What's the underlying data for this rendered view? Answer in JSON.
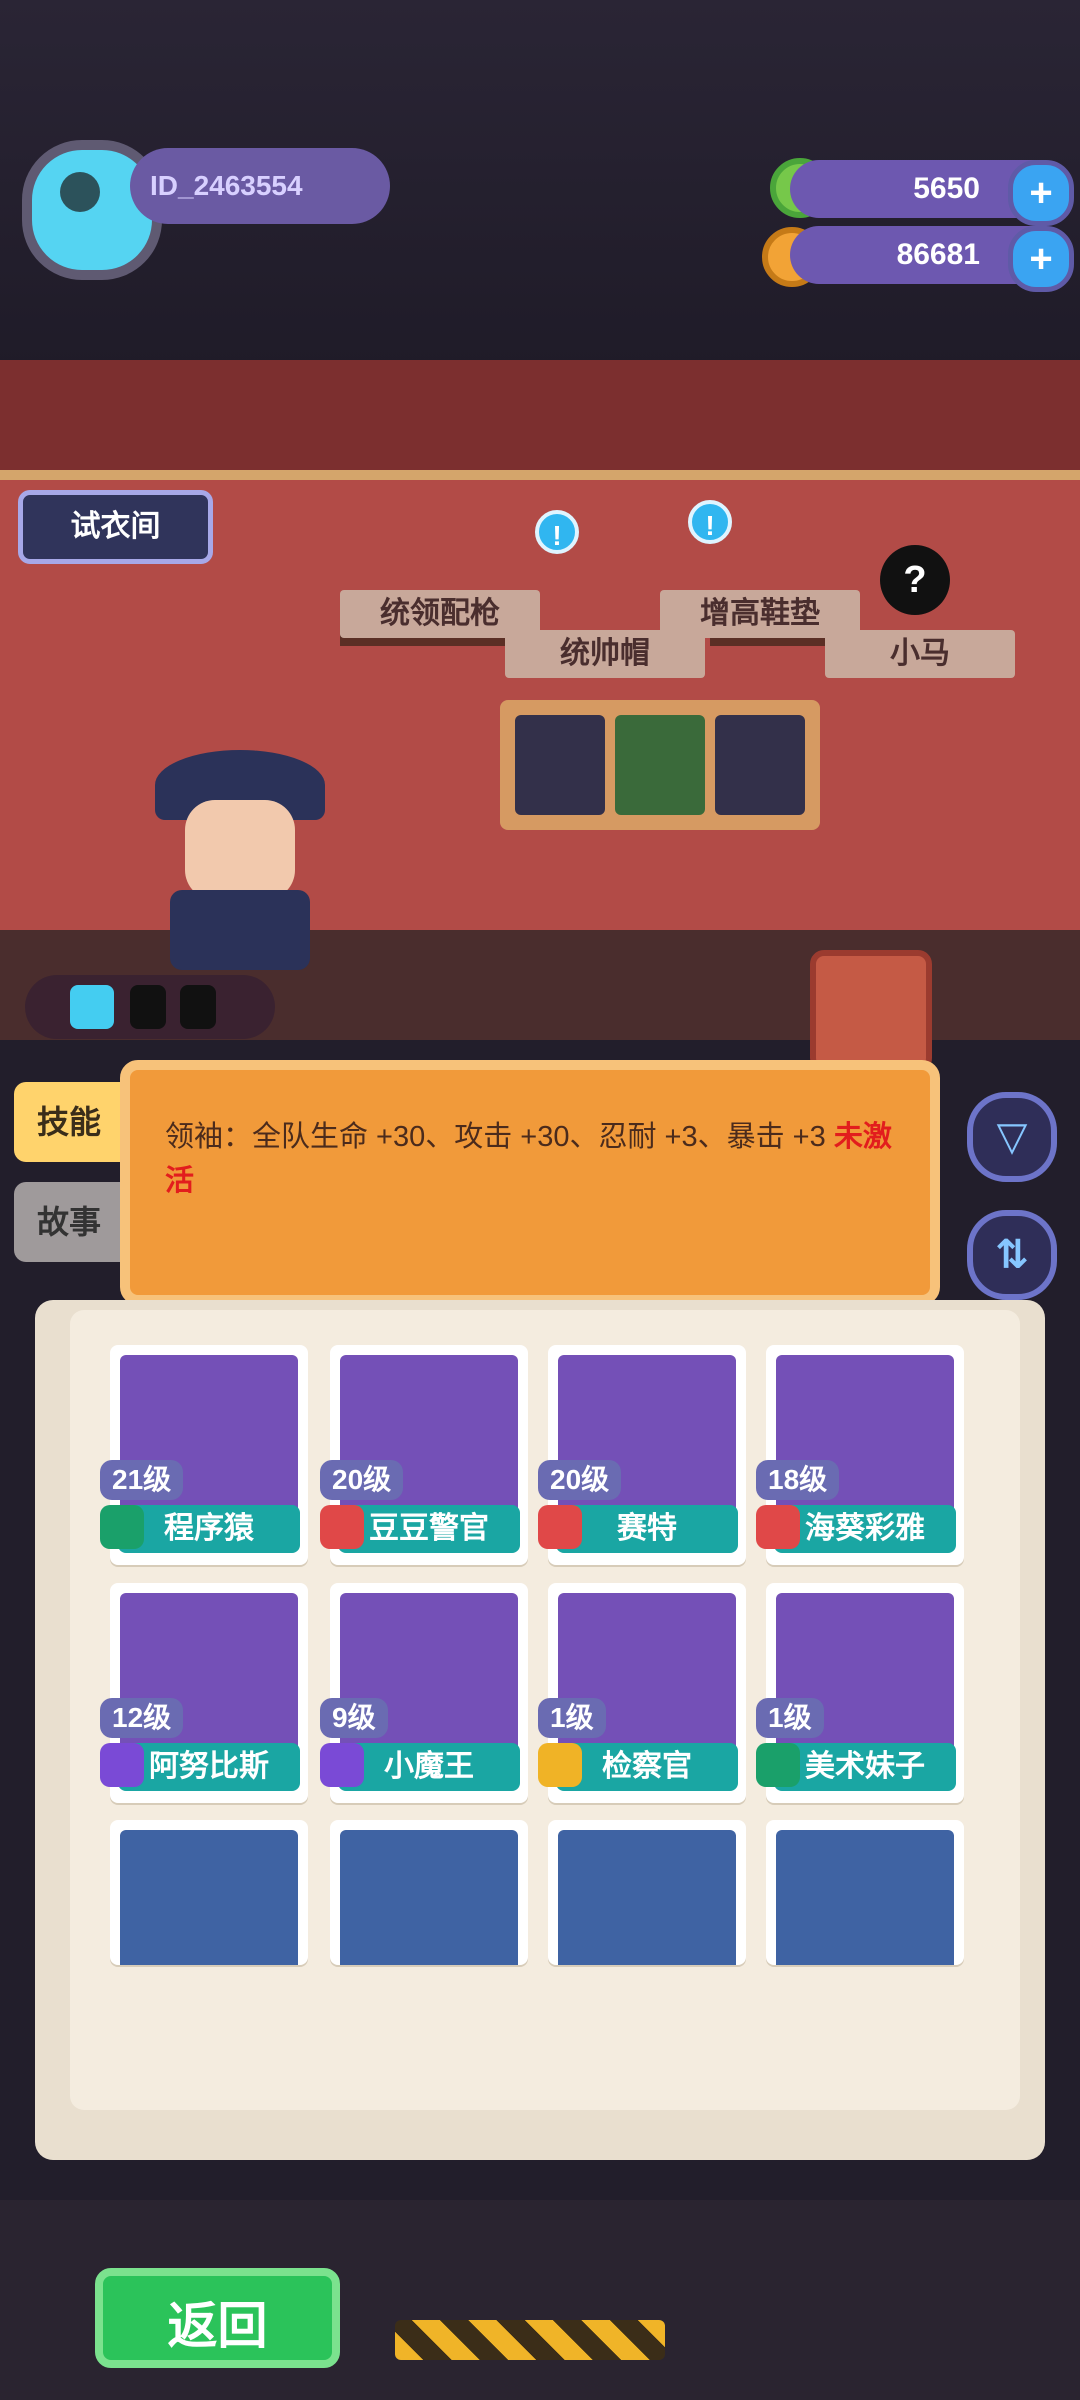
{
  "player": {
    "id": "ID_2463554"
  },
  "currency": {
    "green": "5650",
    "gold": "86681"
  },
  "room": {
    "fitting_room_label": "试衣间",
    "items": [
      {
        "label": "统领配枪"
      },
      {
        "label": "统帅帽"
      },
      {
        "label": "增高鞋垫"
      },
      {
        "label": "小马"
      }
    ]
  },
  "tabs": {
    "skill": "技能",
    "story": "故事"
  },
  "skill": {
    "text": "领袖：全队生命 +30、攻击 +30、忍耐 +3、暴击 +3",
    "status": "未激活"
  },
  "characters": [
    {
      "level": "21级",
      "name": "程序猿",
      "rank_color": "#1aa06a",
      "portrait_color": "#7450b7"
    },
    {
      "level": "20级",
      "name": "豆豆警官",
      "rank_color": "#e04848",
      "portrait_color": "#7450b7"
    },
    {
      "level": "20级",
      "name": "赛特",
      "rank_color": "#e04848",
      "portrait_color": "#7450b7"
    },
    {
      "level": "18级",
      "name": "海葵彩雅",
      "rank_color": "#e04848",
      "portrait_color": "#7450b7"
    },
    {
      "level": "12级",
      "name": "阿努比斯",
      "rank_color": "#7a4ad6",
      "portrait_color": "#7450b7"
    },
    {
      "level": "9级",
      "name": "小魔王",
      "rank_color": "#7a4ad6",
      "portrait_color": "#7450b7"
    },
    {
      "level": "1级",
      "name": "检察官",
      "rank_color": "#f0b326",
      "portrait_color": "#7450b7"
    },
    {
      "level": "1级",
      "name": "美术妹子",
      "rank_color": "#1aa06a",
      "portrait_color": "#7450b7"
    },
    {
      "portrait_color": "#3f63a3"
    },
    {
      "portrait_color": "#3f63a3"
    },
    {
      "portrait_color": "#3f63a3"
    },
    {
      "portrait_color": "#3f63a3"
    }
  ],
  "bottom": {
    "back": "返回"
  }
}
